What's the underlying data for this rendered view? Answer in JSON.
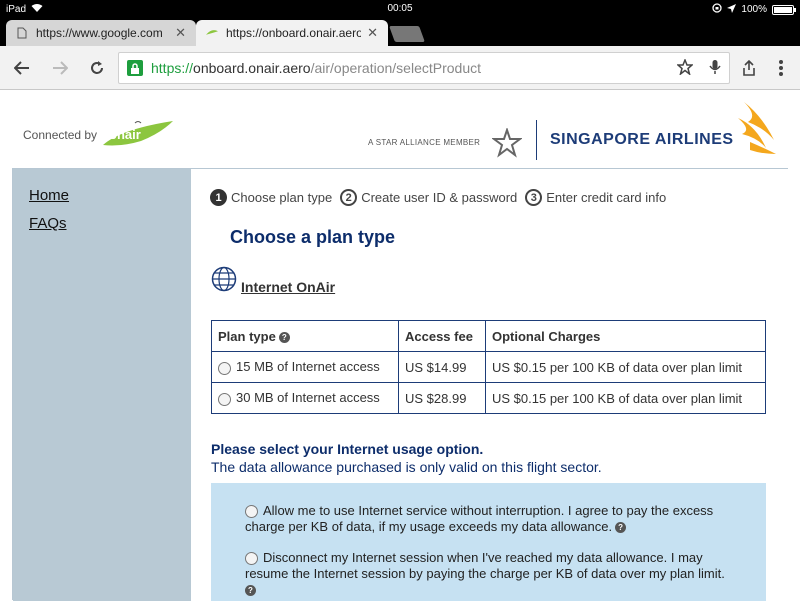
{
  "status_bar": {
    "device": "iPad",
    "time": "00:05",
    "battery": "100%",
    "battery_fraction": 1.0
  },
  "tabs": [
    {
      "title": "https://www.google.com",
      "active": false
    },
    {
      "title": "https://onboard.onair.aero/air/operation/selectProduct",
      "active": true
    }
  ],
  "omnibox": {
    "scheme": "https://",
    "host": "onboard.onair.aero",
    "path": "/air/operation/selectProduct"
  },
  "header": {
    "connected_by": "Connected by",
    "onair_logo_text": "onair",
    "star_alliance": "A STAR ALLIANCE MEMBER",
    "airline": "SINGAPORE AIRLINES"
  },
  "sidebar": {
    "items": [
      {
        "label": "Home"
      },
      {
        "label": "FAQs"
      }
    ]
  },
  "steps": [
    {
      "num": "1",
      "label": "Choose plan type"
    },
    {
      "num": "2",
      "label": "Create user ID & password"
    },
    {
      "num": "3",
      "label": "Enter credit card info"
    }
  ],
  "page_title": "Choose a plan type",
  "product_name": "Internet OnAir",
  "table": {
    "headers": [
      "Plan type",
      "Access fee",
      "Optional Charges"
    ],
    "rows": [
      {
        "plan": "15 MB of Internet access",
        "fee": "US $14.99",
        "charges": "US $0.15 per 100 KB of data over plan limit"
      },
      {
        "plan": "30 MB of Internet access",
        "fee": "US $28.99",
        "charges": "US $0.15 per 100 KB of data over plan limit"
      }
    ]
  },
  "usage": {
    "title": "Please select your Internet usage option.",
    "subtitle": "The data allowance purchased is only valid on this flight sector.",
    "options": [
      "Allow me to use Internet service without interruption. I agree to pay the excess charge per KB of data, if my usage exceeds my data allowance.",
      "Disconnect my Internet session when I've reached my data allowance. I may resume the Internet session by paying the charge per KB of data over my plan limit."
    ]
  },
  "colors": {
    "sidebar": "#b8c9d4",
    "accent_navy": "#0d2d6b",
    "options_bg": "#c6e1f2",
    "secure_green": "#1e9e3e"
  }
}
